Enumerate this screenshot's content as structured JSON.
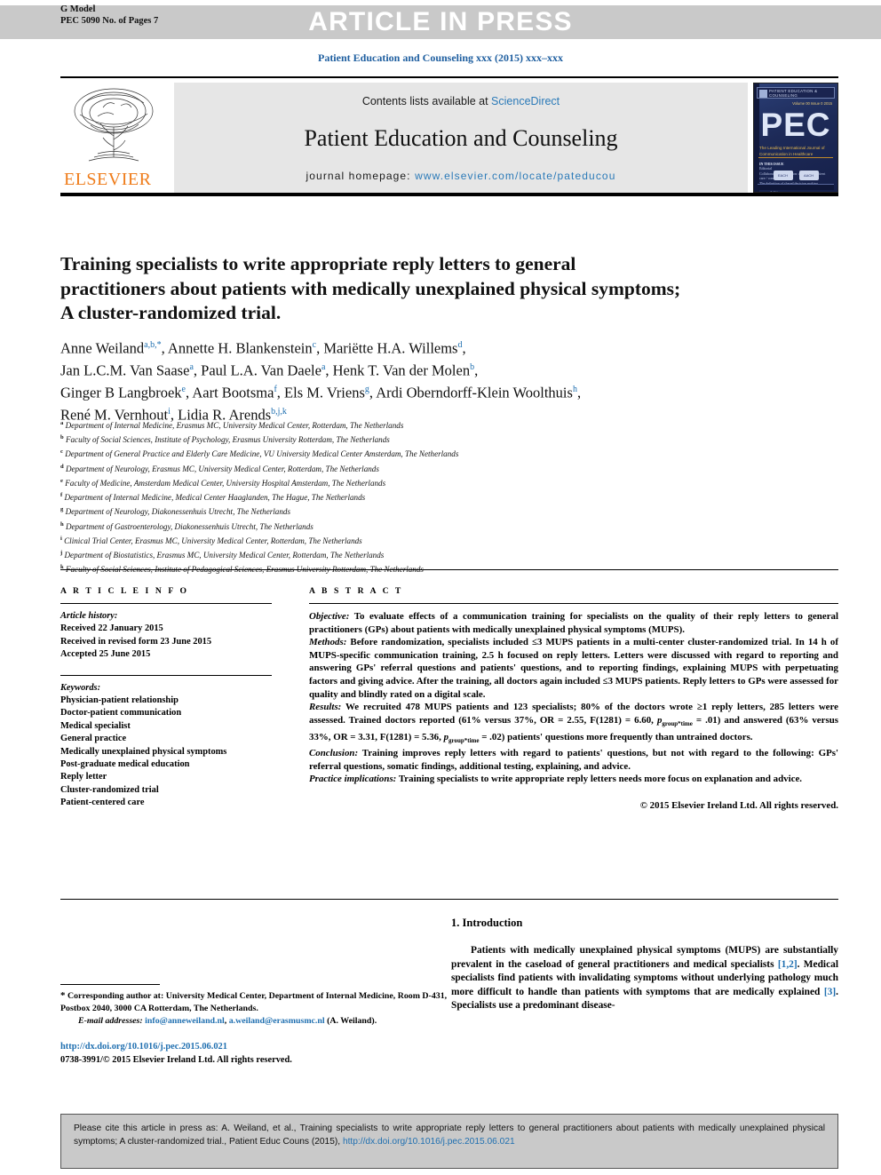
{
  "header": {
    "g_model": "G Model",
    "pec_pages": "PEC 5090 No. of Pages 7",
    "article_in_press": "ARTICLE IN PRESS",
    "journal_line": "Patient Education and Counseling xxx (2015) xxx–xxx"
  },
  "masthead": {
    "contents_prefix": "Contents lists available at ",
    "sciencedirect": "ScienceDirect",
    "journal_name": "Patient Education and Counseling",
    "homepage_label": "journal homepage: ",
    "homepage_url": "www.elsevier.com/locate/pateducou",
    "elsevier_wordmark": "ELSEVIER",
    "cover": {
      "top_strip": "PATIENT EDUCATION & COUNSELING",
      "issue": "Volume 00\nIssue 0 2015",
      "title_abbr": "PEC",
      "tagline": "The Leading International Journal\nof Communication in Healthcare",
      "body_heading": "IN THIS ISSUE",
      "body_lines": "Editorial\nCollaborative deliberation: a model for patient\ncare / consultation\nThe definition of shared decision making\npatient and doctor in a dialogue / clinicians\nresponsibilities",
      "logo_1": "EACH",
      "logo_2": "AACH"
    }
  },
  "article": {
    "title": "Training specialists to write appropriate reply letters to general practitioners about patients with medically unexplained physical symptoms; A cluster-randomized trial.",
    "authors_html": "Anne Weiland<sup>a,b,*</sup>, Annette H. Blankenstein<sup>c</sup>, Mariëtte H.A. Willems<sup>d</sup>,<br>Jan L.C.M. Van Saase<sup>a</sup>, Paul L.A. Van Daele<sup>a</sup>, Henk T. Van der Molen<sup>b</sup>,<br>Ginger B Langbroek<sup>e</sup>, Aart Bootsma<sup>f</sup>, Els M. Vriens<sup>g</sup>, Ardi Oberndorff-Klein Woolthuis<sup>h</sup>,<br>René M. Vernhout<sup>i</sup>, Lidia R. Arends<sup>b,j,k</sup>",
    "affiliations": [
      {
        "label": "a",
        "text": "Department of Internal Medicine, Erasmus MC, University Medical Center, Rotterdam, The Netherlands"
      },
      {
        "label": "b",
        "text": "Faculty of Social Sciences, Institute of Psychology, Erasmus University Rotterdam, The Netherlands"
      },
      {
        "label": "c",
        "text": "Department of General Practice and Elderly Care Medicine, VU University Medical Center Amsterdam, The Netherlands"
      },
      {
        "label": "d",
        "text": "Department of Neurology, Erasmus MC, University Medical Center, Rotterdam, The Netherlands"
      },
      {
        "label": "e",
        "text": "Faculty of Medicine, Amsterdam Medical Center, University Hospital Amsterdam, The Netherlands"
      },
      {
        "label": "f",
        "text": "Department of Internal Medicine, Medical Center Haaglanden, The Hague, The Netherlands"
      },
      {
        "label": "g",
        "text": "Department of Neurology, Diakonessenhuis Utrecht, The Netherlands"
      },
      {
        "label": "h",
        "text": "Department of Gastroenterology, Diakonessenhuis Utrecht, The Netherlands"
      },
      {
        "label": "i",
        "text": "Clinical Trial Center, Erasmus MC, University Medical Center, Rotterdam, The Netherlands"
      },
      {
        "label": "j",
        "text": "Department of Biostatistics, Erasmus MC, University Medical Center, Rotterdam, The Netherlands"
      },
      {
        "label": "k",
        "text": "Faculty of Social Sciences, Institute of Pedagogical Sciences, Erasmus University Rotterdam, The Netherlands"
      }
    ]
  },
  "article_info": {
    "heading": "A R T I C L E  I N F O",
    "history_label": "Article history:",
    "history": [
      "Received 22 January 2015",
      "Received in revised form 23 June 2015",
      "Accepted 25 June 2015"
    ],
    "keywords_label": "Keywords:",
    "keywords": [
      "Physician-patient relationship",
      "Doctor-patient communication",
      "Medical specialist",
      "General practice",
      "Medically unexplained physical symptoms",
      "Post-graduate medical education",
      "Reply letter",
      "Cluster-randomized trial",
      "Patient-centered care"
    ]
  },
  "abstract": {
    "heading": "A B S T R A C T",
    "objective_label": "Objective:",
    "objective": " To evaluate effects of a communication training for specialists on the quality of their reply letters to general practitioners (GPs) about patients with medically unexplained physical symptoms (MUPS).",
    "methods_label": "Methods:",
    "methods": " Before randomization, specialists included ≤3 MUPS patients in a multi-center cluster-randomized trial. In 14 h of MUPS-specific communication training, 2.5 h focused on reply letters. Letters were discussed with regard to reporting and answering GPs' referral questions and patients' questions, and to reporting findings, explaining MUPS with perpetuating factors and giving advice. After the training, all doctors again included ≤3 MUPS patients. Reply letters to GPs were assessed for quality and blindly rated on a digital scale.",
    "results_label": "Results:",
    "results_html": " We recruited 478 MUPS patients and 123 specialists; 80% of the doctors wrote ≥1 reply letters, 285 letters were assessed. Trained doctors reported (61% versus 37%, OR = 2.55, F(1281) = 6.60, <i>p</i><span class=\"abs-sub\">group*time</span> = .01) and answered (63% versus 33%, OR = 3.31, F(1281) = 5.36, <i>p</i><span class=\"abs-sub\">group*time</span> = .02) patients' questions more frequently than untrained doctors.",
    "conclusion_label": "Conclusion:",
    "conclusion": " Training improves reply letters with regard to patients' questions, but not with regard to the following: GPs' referral questions, somatic findings, additional testing, explaining, and advice.",
    "practice_label": "Practice implications:",
    "practice": " Training specialists to write appropriate reply letters needs more focus on explanation and advice.",
    "copyright": "© 2015 Elsevier Ireland Ltd. All rights reserved."
  },
  "introduction": {
    "heading": "1. Introduction",
    "paragraph_html": "Patients with medically unexplained physical symptoms (MUPS) are substantially prevalent in the caseload of general practitioners and medical specialists <span class=\"ref\">[1,2]</span>. Medical specialists find patients with invalidating symptoms without underlying pathology much more difficult to handle than patients with symptoms that are medically explained <span class=\"ref\">[3]</span>. Specialists use a predominant disease-"
  },
  "footnote": {
    "star": "*",
    "corresponding_text": " Corresponding author at: University Medical Center, Department of Internal Medicine, Room D-431, Postbox 2040, 3000 CA Rotterdam, The Netherlands.",
    "email_label": "E-mail addresses:",
    "email_1": "info@anneweiland.nl",
    "email_2": "a.weiland@erasmusmc.nl",
    "email_suffix": " (A. Weiland).",
    "doi_url": "http://dx.doi.org/10.1016/j.pec.2015.06.021",
    "issn_line": "0738-3991/© 2015 Elsevier Ireland Ltd. All rights reserved."
  },
  "citation_box": {
    "text_part_1": "Please cite this article in press as: A. Weiland, et al., Training specialists to write appropriate reply letters to general practitioners about patients with medically unexplained physical symptoms; A cluster-randomized trial., Patient Educ Couns (2015), ",
    "link": "http://dx.doi.org/10.1016/j.pec.2015.06.021"
  },
  "colors": {
    "link_blue": "#1f6fb0",
    "elsevier_orange": "#ef7c1a",
    "bar_gray": "#c9c9c9"
  }
}
